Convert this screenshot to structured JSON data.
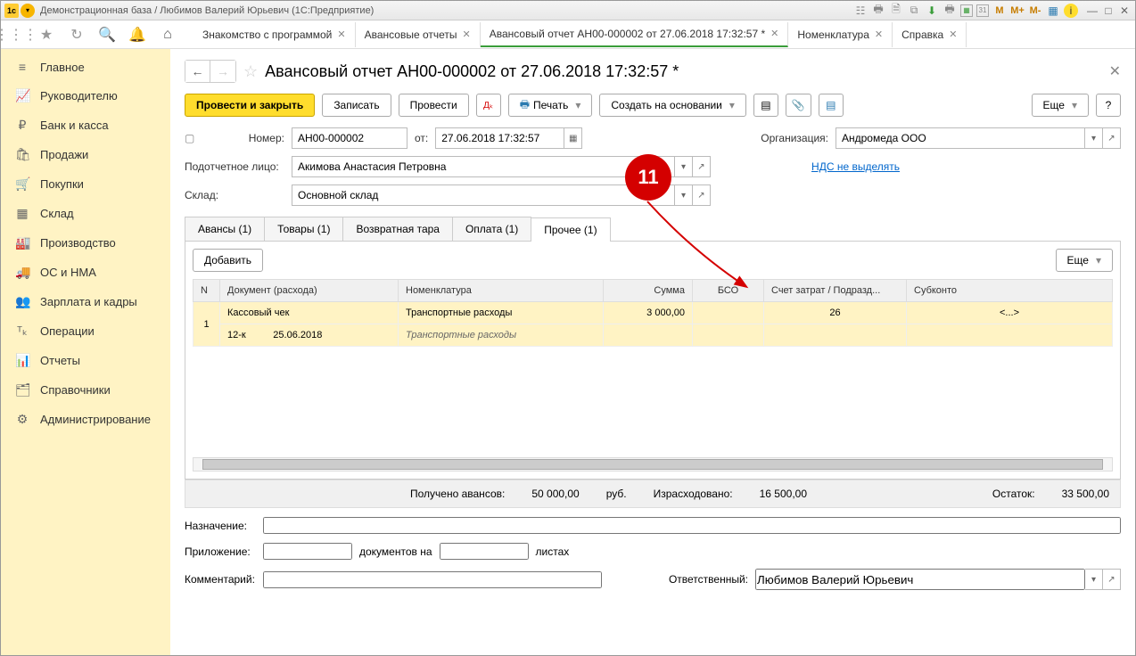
{
  "window": {
    "title": "Демонстрационная база / Любимов Валерий Юрьевич  (1С:Предприятие)"
  },
  "tabs": {
    "t0": "Знакомство с программой",
    "t1": "Авансовые отчеты",
    "t2": "Авансовый отчет АН00-000002 от 27.06.2018 17:32:57 *",
    "t3": "Номенклатура",
    "t4": "Справка"
  },
  "sidebar": {
    "main": "Главное",
    "dir": "Руководителю",
    "bank": "Банк и касса",
    "sales": "Продажи",
    "purch": "Покупки",
    "stock": "Склад",
    "prod": "Производство",
    "os": "ОС и НМА",
    "zar": "Зарплата и кадры",
    "ops": "Операции",
    "rep": "Отчеты",
    "ref": "Справочники",
    "adm": "Администрирование"
  },
  "page": {
    "title": "Авансовый отчет АН00-000002 от 27.06.2018 17:32:57 *",
    "callout": "11"
  },
  "cmd": {
    "post_close": "Провести и закрыть",
    "save": "Записать",
    "post": "Провести",
    "print": "Печать",
    "create_base": "Создать на основании",
    "more": "Еще",
    "help": "?"
  },
  "form": {
    "num_lbl": "Номер:",
    "num": "АН00-000002",
    "from_lbl": "от:",
    "date": "27.06.2018 17:32:57",
    "org_lbl": "Организация:",
    "org": "Андромеда ООО",
    "person_lbl": "Подотчетное лицо:",
    "person": "Акимова Анастасия Петровна",
    "vat": "НДС не выделять",
    "wh_lbl": "Склад:",
    "wh": "Основной склад"
  },
  "doctabs": {
    "adv": "Авансы (1)",
    "goods": "Товары (1)",
    "tara": "Возвратная тара",
    "pay": "Оплата (1)",
    "other": "Прочее (1)"
  },
  "tbltb": {
    "add": "Добавить",
    "more": "Еще"
  },
  "cols": {
    "n": "N",
    "doc": "Документ (расхода)",
    "nom": "Номенклатура",
    "sum": "Сумма",
    "bso": "БСО",
    "acc": "Счет затрат / Подразд...",
    "sub": "Субконто"
  },
  "row1": {
    "n": "1",
    "doc": "Кассовый чек",
    "nom": "Транспортные расходы",
    "sum": "3 000,00",
    "acc": "26",
    "sub": "<...>",
    "docnum": "12-к",
    "docdate": "25.06.2018",
    "nom2": "Транспортные расходы"
  },
  "summary": {
    "recv_lbl": "Получено авансов:",
    "recv": "50 000,00",
    "cur": "руб.",
    "spent_lbl": "Израсходовано:",
    "spent": "16 500,00",
    "rest_lbl": "Остаток:",
    "rest": "33 500,00"
  },
  "bottom": {
    "dest_lbl": "Назначение:",
    "att_lbl": "Приложение:",
    "docs_on": "документов на",
    "sheets": "листах",
    "comm_lbl": "Комментарий:",
    "resp_lbl": "Ответственный:",
    "resp": "Любимов Валерий Юрьевич"
  }
}
